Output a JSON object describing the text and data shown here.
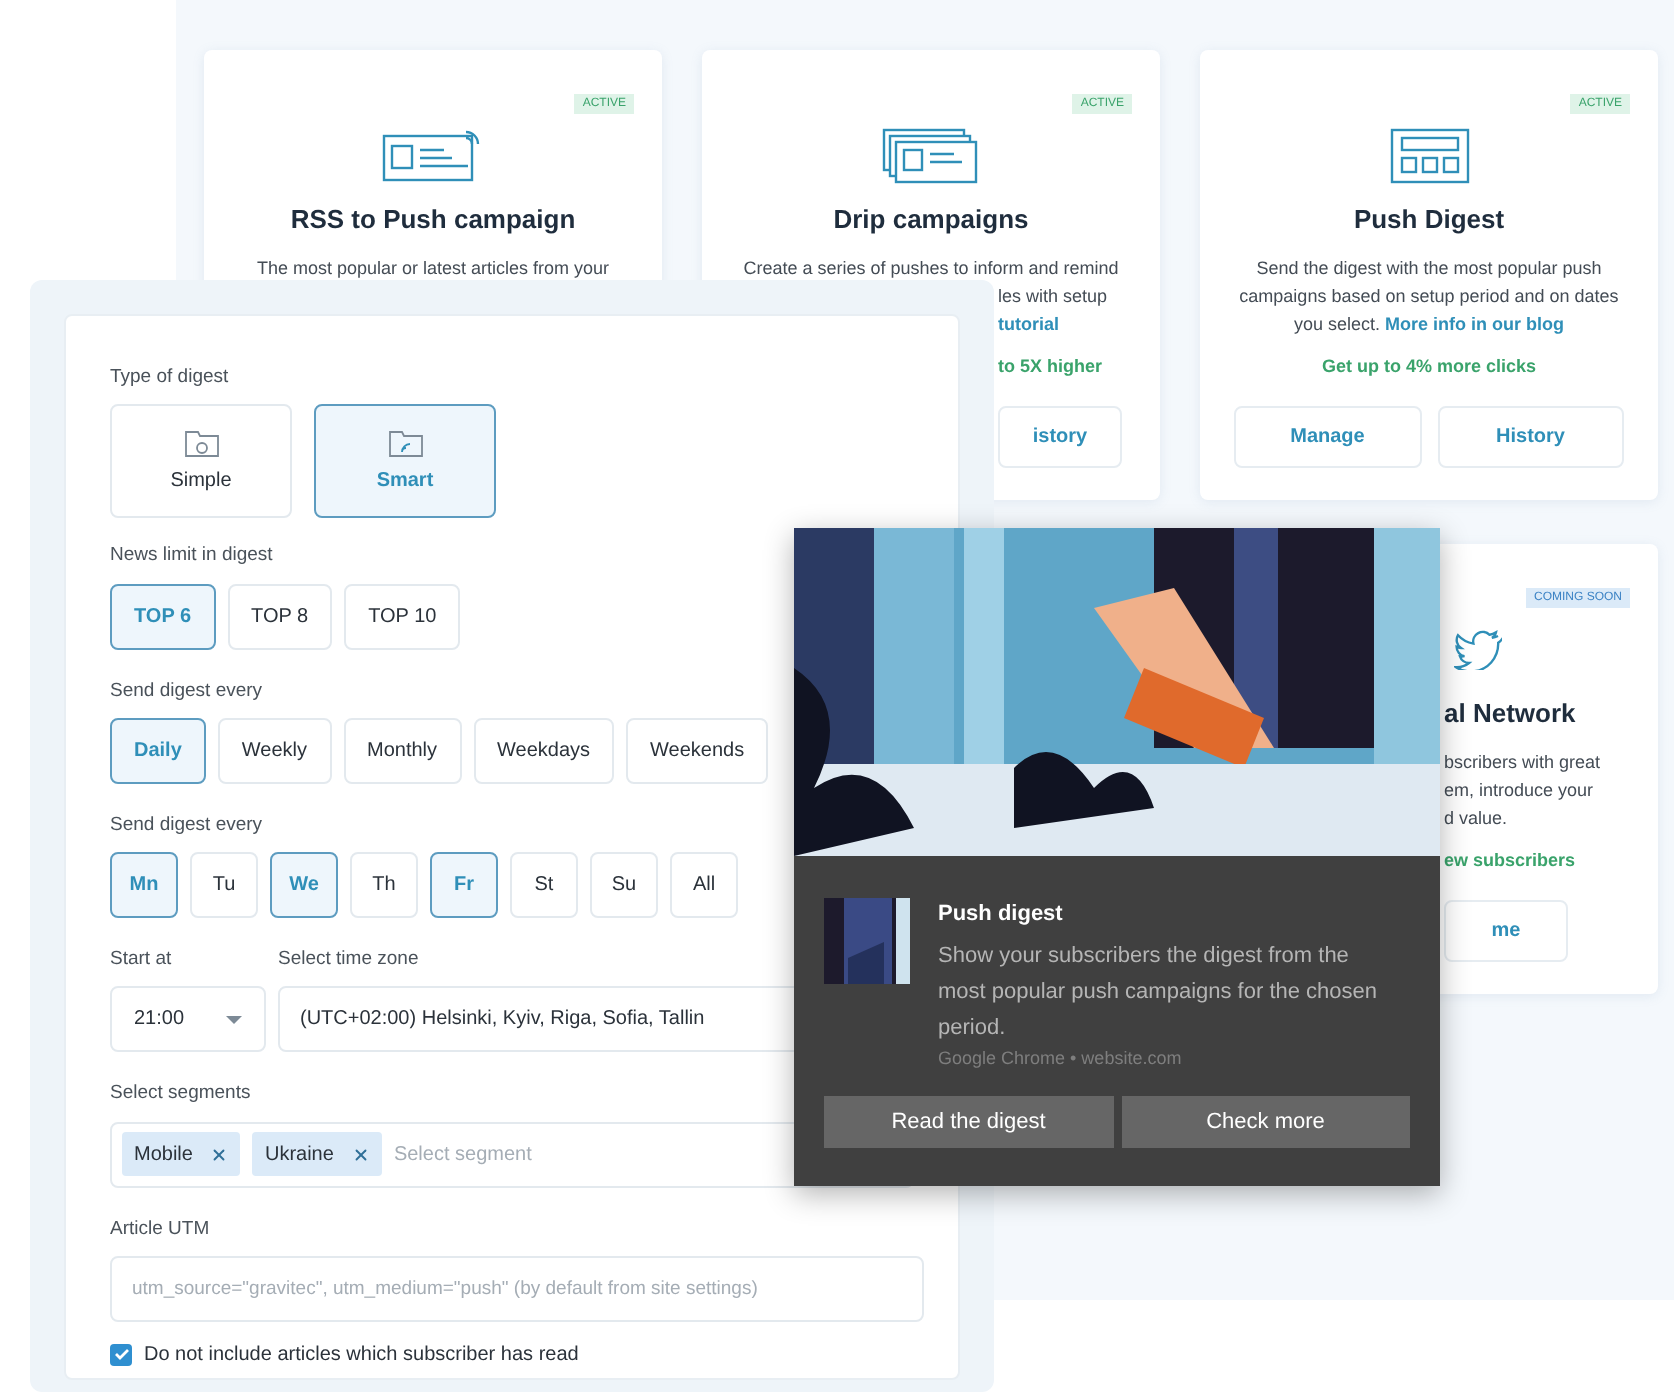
{
  "cards": [
    {
      "badge": "ACTIVE",
      "kind": "active",
      "title": "RSS to Push campaign",
      "lines": [
        "The most popular or latest articles from your"
      ]
    },
    {
      "badge": "ACTIVE",
      "kind": "active",
      "title": "Drip campaigns",
      "lines": [
        "Create a series of pushes to inform and remind",
        "les with setup"
      ],
      "link": "tutorial",
      "highlight": "to 5X higher",
      "buttons": [
        "istory"
      ]
    },
    {
      "badge": "ACTIVE",
      "kind": "active",
      "title": "Push Digest",
      "description": "Send the digest with the most popular push campaigns based on setup period and on dates you select.",
      "link": "More info in our blog",
      "highlight": "Get up to 4% more clicks",
      "buttons": [
        "Manage",
        "History"
      ]
    },
    {
      "badge": "COMING SOON",
      "kind": "soon",
      "title": "al Network",
      "lines": [
        "bscribers with great",
        "em, introduce your",
        "d value."
      ],
      "highlight": "ew subscribers",
      "buttons": [
        "me"
      ]
    }
  ],
  "form": {
    "digest_type": {
      "label": "Type of digest",
      "options": [
        {
          "label": "Simple",
          "selected": false
        },
        {
          "label": "Smart",
          "selected": true
        }
      ]
    },
    "news_limit": {
      "label": "News limit in digest",
      "options": [
        {
          "label": "TOP 6",
          "selected": true
        },
        {
          "label": "TOP 8",
          "selected": false
        },
        {
          "label": "TOP 10",
          "selected": false
        }
      ]
    },
    "frequency": {
      "label": "Send digest every",
      "options": [
        {
          "label": "Daily",
          "selected": true
        },
        {
          "label": "Weekly",
          "selected": false
        },
        {
          "label": "Monthly",
          "selected": false
        },
        {
          "label": "Weekdays",
          "selected": false
        },
        {
          "label": "Weekends",
          "selected": false
        }
      ]
    },
    "days": {
      "label": "Send digest every",
      "options": [
        {
          "label": "Mn",
          "selected": true
        },
        {
          "label": "Tu",
          "selected": false
        },
        {
          "label": "We",
          "selected": true
        },
        {
          "label": "Th",
          "selected": false
        },
        {
          "label": "Fr",
          "selected": true
        },
        {
          "label": "St",
          "selected": false
        },
        {
          "label": "Su",
          "selected": false
        },
        {
          "label": "All",
          "selected": false
        }
      ]
    },
    "start_at": {
      "label": "Start at",
      "value": "21:00"
    },
    "time_zone": {
      "label": "Select time zone",
      "value": "(UTC+02:00) Helsinki, Kyiv, Riga, Sofia, Tallin"
    },
    "segments": {
      "label": "Select segments",
      "chips": [
        "Mobile",
        "Ukraine"
      ],
      "placeholder": "Select segment"
    },
    "utm": {
      "label": "Article UTM",
      "placeholder": "utm_source=\"gravitec\", utm_medium=\"push\" (by default from site settings)"
    },
    "exclude_read": {
      "label": "Do not include articles which subscriber has read",
      "checked": true
    }
  },
  "notification": {
    "title": "Push digest",
    "body": "Show your subscribers the digest from the most popular push campaigns for the chosen period.",
    "source": "Google Chrome • website.com",
    "buttons": [
      "Read the digest",
      "Check more"
    ]
  }
}
